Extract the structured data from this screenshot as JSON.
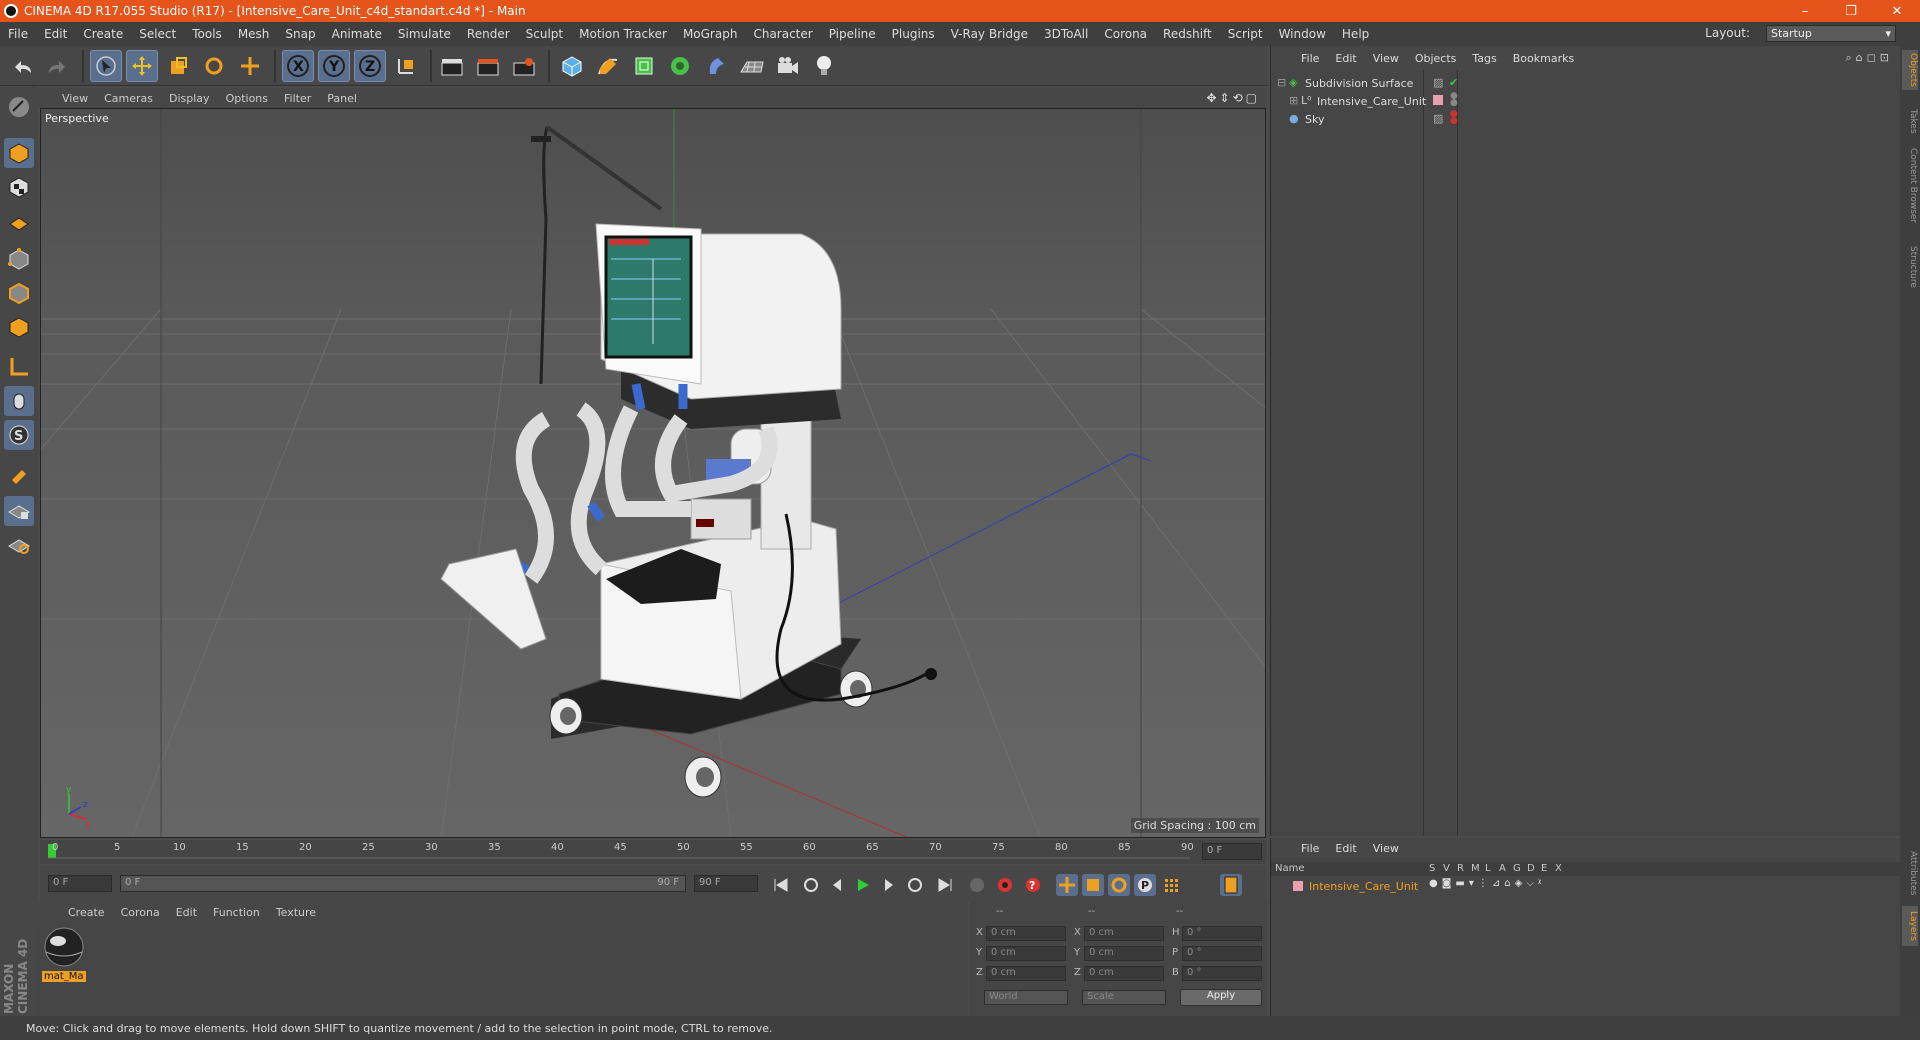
{
  "window": {
    "title": "CINEMA 4D R17.055 Studio (R17) - [Intensive_Care_Unit_c4d_standart.c4d *] - Main",
    "minimize": "–",
    "restore": "❐",
    "close": "✕"
  },
  "menu": [
    "File",
    "Edit",
    "Create",
    "Select",
    "Tools",
    "Mesh",
    "Snap",
    "Animate",
    "Simulate",
    "Render",
    "Sculpt",
    "Motion Tracker",
    "MoGraph",
    "Character",
    "Pipeline",
    "Plugins",
    "V-Ray Bridge",
    "3DToAll",
    "Corona",
    "Redshift",
    "Script",
    "Window",
    "Help"
  ],
  "layout": {
    "label": "Layout:",
    "value": "Startup"
  },
  "viewport": {
    "menu": [
      "View",
      "Cameras",
      "Display",
      "Options",
      "Filter",
      "Panel"
    ],
    "camera": "Perspective",
    "grid_spacing": "Grid Spacing : 100 cm"
  },
  "timeline": {
    "ticks": [
      "0",
      "5",
      "10",
      "15",
      "20",
      "25",
      "30",
      "35",
      "40",
      "45",
      "50",
      "55",
      "60",
      "65",
      "70",
      "75",
      "80",
      "85",
      "90"
    ],
    "current": "0 F",
    "start": "0 F",
    "range_start": "0 F",
    "range_end": "90 F",
    "end": "90 F"
  },
  "material_panel": {
    "menu": [
      "Create",
      "Corona",
      "Edit",
      "Function",
      "Texture"
    ],
    "materials": [
      {
        "name": "mat_Ma"
      }
    ]
  },
  "coords": {
    "header": [
      "--",
      "--",
      "--"
    ],
    "rows": [
      {
        "a": "X",
        "av": "0 cm",
        "b": "X",
        "bv": "0 cm",
        "c": "H",
        "cv": "0 °"
      },
      {
        "a": "Y",
        "av": "0 cm",
        "b": "Y",
        "bv": "0 cm",
        "c": "P",
        "cv": "0 °"
      },
      {
        "a": "Z",
        "av": "0 cm",
        "b": "Z",
        "bv": "0 cm",
        "c": "B",
        "cv": "0 °"
      }
    ],
    "space": "World",
    "mode": "Scale",
    "apply": "Apply"
  },
  "objects": {
    "menu": [
      "File",
      "Edit",
      "View",
      "Objects",
      "Tags",
      "Bookmarks"
    ],
    "items": [
      {
        "name": "Subdivision Surface",
        "depth": 0
      },
      {
        "name": "Intensive_Care_Unit",
        "depth": 1
      },
      {
        "name": "Sky",
        "depth": 0
      }
    ]
  },
  "layers": {
    "menu": [
      "File",
      "Edit",
      "View"
    ],
    "header_name": "Name",
    "flags": [
      "S",
      "V",
      "R",
      "M",
      "L",
      "A",
      "G",
      "D",
      "E",
      "X"
    ],
    "items": [
      {
        "name": "Intensive_Care_Unit",
        "color": "#e8a0b0"
      }
    ]
  },
  "right_tabs": [
    "Objects",
    "Takes",
    "Content Browser",
    "Structure"
  ],
  "right_tabs_bottom": [
    "Attributes",
    "Layers"
  ],
  "brand": "MAXON CINEMA 4D",
  "status": "Move: Click and drag to move elements. Hold down SHIFT to quantize movement / add to the selection in point mode, CTRL to remove.",
  "colors": {
    "accent": "#e5541a",
    "selection": "#5a6e8e",
    "axis_x": "#e23",
    "axis_y": "#3c3",
    "axis_z": "#33d"
  }
}
